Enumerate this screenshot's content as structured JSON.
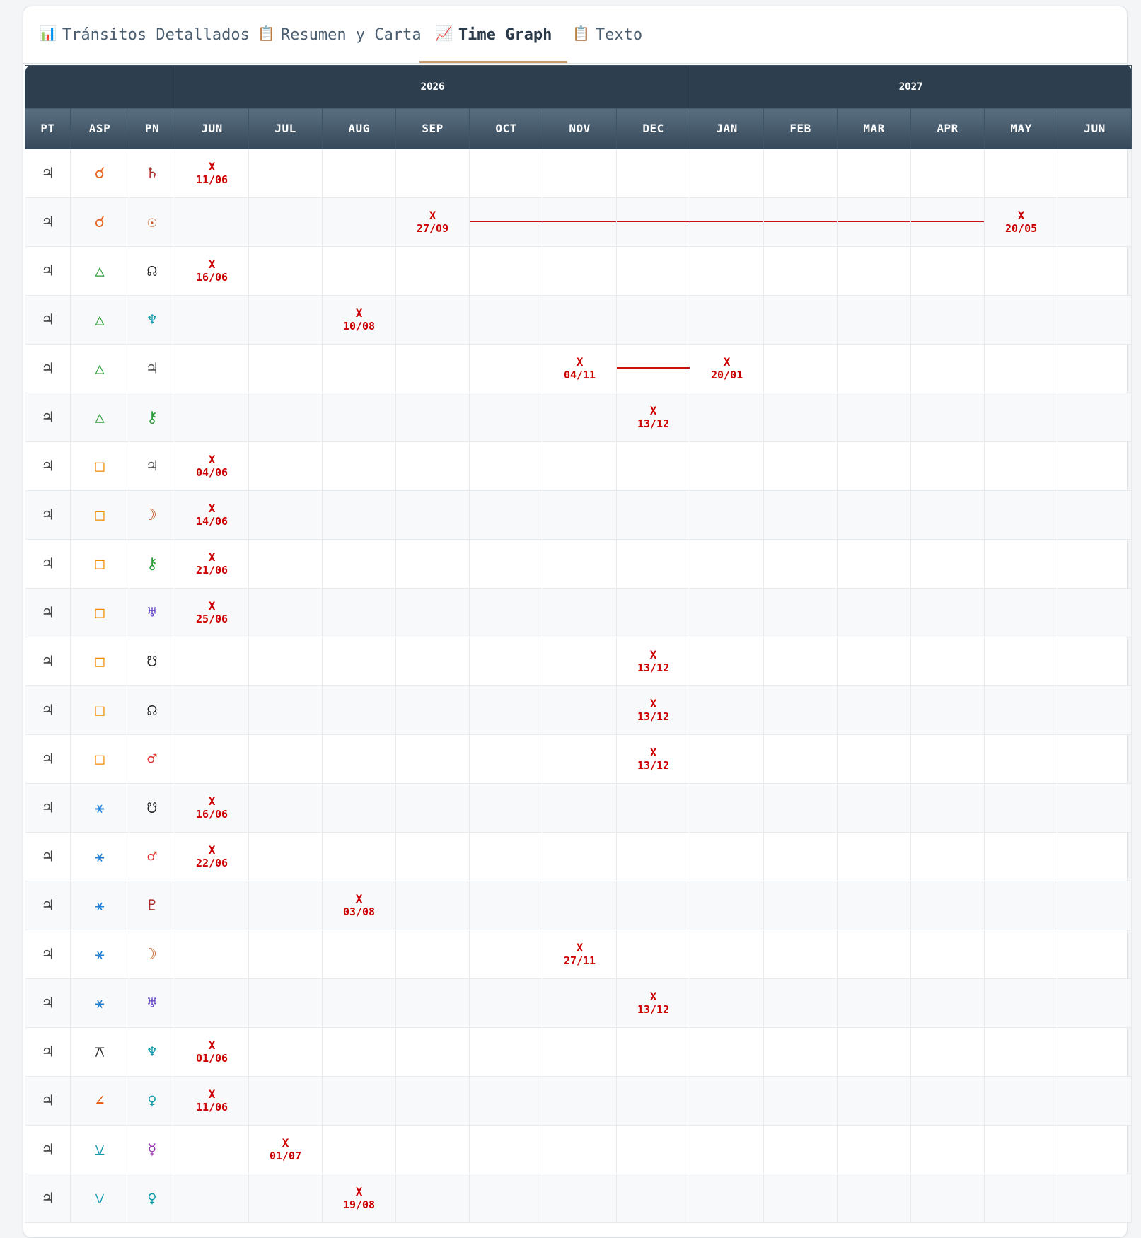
{
  "tabs": [
    {
      "icon": "📊",
      "label": "Tránsitos Detallados",
      "active": false
    },
    {
      "icon": "📋",
      "label": "Resumen y Carta",
      "active": false
    },
    {
      "icon": "📈",
      "label": "Time Graph",
      "active": true
    },
    {
      "icon": "📋",
      "label": "Texto",
      "active": false
    }
  ],
  "years": [
    {
      "label": "2026",
      "span": 7
    },
    {
      "label": "2027",
      "span": 6
    }
  ],
  "fixed_headers": [
    "PT",
    "ASP",
    "PN"
  ],
  "months": [
    "JUN",
    "JUL",
    "AUG",
    "SEP",
    "OCT",
    "NOV",
    "DEC",
    "JAN",
    "FEB",
    "MAR",
    "APR",
    "MAY",
    "JUN"
  ],
  "colors": {
    "mark": "#cc0000",
    "conjunction": "#e8672a",
    "trine": "#2e9e3a",
    "square": "#f08c00",
    "sextile": "#1c7ed6",
    "quincunx": "#1098ad",
    "semisquare": "#e8590c"
  },
  "rows": [
    {
      "pt": "♃",
      "asp": "☌",
      "asp_color": "#e8672a",
      "pn": "♄",
      "pn_color": "#b02a2a",
      "marks": [
        {
          "col": 0,
          "label": "X",
          "date": "11/06"
        }
      ]
    },
    {
      "pt": "♃",
      "asp": "☌",
      "asp_color": "#e8672a",
      "pn": "☉",
      "pn_color": "#c0561b",
      "marks": [
        {
          "col": 3,
          "label": "X",
          "date": "27/09"
        },
        {
          "col": 11,
          "label": "X",
          "date": "20/05"
        }
      ],
      "span": [
        4,
        10
      ]
    },
    {
      "pt": "♃",
      "asp": "△",
      "asp_color": "#2e9e3a",
      "pn": "☊",
      "pn_color": "#222222",
      "marks": [
        {
          "col": 0,
          "label": "X",
          "date": "16/06"
        }
      ]
    },
    {
      "pt": "♃",
      "asp": "△",
      "asp_color": "#2e9e3a",
      "pn": "♆",
      "pn_color": "#1098ad",
      "marks": [
        {
          "col": 2,
          "label": "X",
          "date": "10/08"
        }
      ]
    },
    {
      "pt": "♃",
      "asp": "△",
      "asp_color": "#2e9e3a",
      "pn": "♃",
      "pn_color": "#555555",
      "marks": [
        {
          "col": 5,
          "label": "X",
          "date": "04/11"
        },
        {
          "col": 7,
          "label": "X",
          "date": "20/01"
        }
      ],
      "span": [
        6,
        6
      ]
    },
    {
      "pt": "♃",
      "asp": "△",
      "asp_color": "#2e9e3a",
      "pn": "⚷",
      "pn_color": "#2e9e3a",
      "marks": [
        {
          "col": 6,
          "label": "X",
          "date": "13/12"
        }
      ]
    },
    {
      "pt": "♃",
      "asp": "□",
      "asp_color": "#f08c00",
      "pn": "♃",
      "pn_color": "#555555",
      "marks": [
        {
          "col": 0,
          "label": "X",
          "date": "04/06"
        }
      ]
    },
    {
      "pt": "♃",
      "asp": "□",
      "asp_color": "#f08c00",
      "pn": "☽",
      "pn_color": "#c0561b",
      "marks": [
        {
          "col": 0,
          "label": "X",
          "date": "14/06"
        }
      ]
    },
    {
      "pt": "♃",
      "asp": "□",
      "asp_color": "#f08c00",
      "pn": "⚷",
      "pn_color": "#2e9e3a",
      "marks": [
        {
          "col": 0,
          "label": "X",
          "date": "21/06"
        }
      ]
    },
    {
      "pt": "♃",
      "asp": "□",
      "asp_color": "#f08c00",
      "pn": "♅",
      "pn_color": "#5f3dc4",
      "marks": [
        {
          "col": 0,
          "label": "X",
          "date": "25/06"
        }
      ]
    },
    {
      "pt": "♃",
      "asp": "□",
      "asp_color": "#f08c00",
      "pn": "☋",
      "pn_color": "#222222",
      "marks": [
        {
          "col": 6,
          "label": "X",
          "date": "13/12"
        }
      ]
    },
    {
      "pt": "♃",
      "asp": "□",
      "asp_color": "#f08c00",
      "pn": "☊",
      "pn_color": "#222222",
      "marks": [
        {
          "col": 6,
          "label": "X",
          "date": "13/12"
        }
      ]
    },
    {
      "pt": "♃",
      "asp": "□",
      "asp_color": "#f08c00",
      "pn": "♂",
      "pn_color": "#e03131",
      "marks": [
        {
          "col": 6,
          "label": "X",
          "date": "13/12"
        }
      ]
    },
    {
      "pt": "♃",
      "asp": "⚹",
      "asp_color": "#1c7ed6",
      "pn": "☋",
      "pn_color": "#222222",
      "marks": [
        {
          "col": 0,
          "label": "X",
          "date": "16/06"
        }
      ]
    },
    {
      "pt": "♃",
      "asp": "⚹",
      "asp_color": "#1c7ed6",
      "pn": "♂",
      "pn_color": "#e03131",
      "marks": [
        {
          "col": 0,
          "label": "X",
          "date": "22/06"
        }
      ]
    },
    {
      "pt": "♃",
      "asp": "⚹",
      "asp_color": "#1c7ed6",
      "pn": "♇",
      "pn_color": "#b02a2a",
      "marks": [
        {
          "col": 2,
          "label": "X",
          "date": "03/08"
        }
      ]
    },
    {
      "pt": "♃",
      "asp": "⚹",
      "asp_color": "#1c7ed6",
      "pn": "☽",
      "pn_color": "#c0561b",
      "marks": [
        {
          "col": 5,
          "label": "X",
          "date": "27/11"
        }
      ]
    },
    {
      "pt": "♃",
      "asp": "⚹",
      "asp_color": "#1c7ed6",
      "pn": "♅",
      "pn_color": "#5f3dc4",
      "marks": [
        {
          "col": 6,
          "label": "X",
          "date": "13/12"
        }
      ]
    },
    {
      "pt": "♃",
      "asp": "⚻",
      "asp_color": "#222222",
      "pn": "♆",
      "pn_color": "#1098ad",
      "marks": [
        {
          "col": 0,
          "label": "X",
          "date": "01/06"
        }
      ]
    },
    {
      "pt": "♃",
      "asp": "∠",
      "asp_color": "#e8590c",
      "pn": "♀",
      "pn_color": "#1098ad",
      "marks": [
        {
          "col": 0,
          "label": "X",
          "date": "11/06"
        }
      ]
    },
    {
      "pt": "♃",
      "asp": "⚺",
      "asp_color": "#1098ad",
      "pn": "☿",
      "pn_color": "#9c36b5",
      "marks": [
        {
          "col": 1,
          "label": "X",
          "date": "01/07"
        }
      ]
    },
    {
      "pt": "♃",
      "asp": "⚺",
      "asp_color": "#1098ad",
      "pn": "♀",
      "pn_color": "#1098ad",
      "marks": [
        {
          "col": 2,
          "label": "X",
          "date": "19/08"
        }
      ]
    }
  ]
}
